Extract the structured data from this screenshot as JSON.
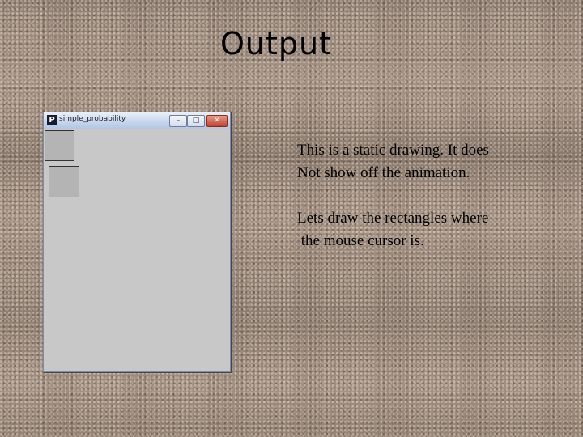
{
  "slide": {
    "title": "Output",
    "paragraph1": [
      "This is a static drawing. It does",
      "Not show off the animation."
    ],
    "paragraph2": [
      "Lets draw the rectangles where",
      " the mouse cursor is."
    ]
  },
  "window": {
    "app_icon_text": "P",
    "title": "simple_probability",
    "buttons": {
      "minimize": "–",
      "maximize": "□",
      "close": "✕"
    },
    "icons": {
      "minimize": "minimize-icon",
      "maximize": "maximize-icon",
      "close": "close-icon",
      "app": "processing-app-icon"
    },
    "canvas_background": "#c8c8c8",
    "rect_fill": "#b4b4b4"
  }
}
